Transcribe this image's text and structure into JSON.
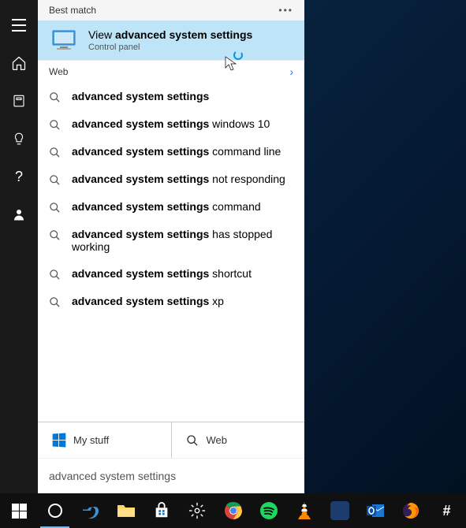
{
  "sidebar": {
    "items": [
      "menu",
      "home",
      "recent",
      "tips",
      "help",
      "account"
    ]
  },
  "panel": {
    "best_match_label": "Best match",
    "best_match": {
      "prefix": "View ",
      "bold": "advanced system settings",
      "sub": "Control panel"
    },
    "web_label": "Web",
    "results": [
      {
        "bold": "advanced system settings",
        "rest": ""
      },
      {
        "bold": "advanced system settings",
        "rest": " windows 10"
      },
      {
        "bold": "advanced system settings",
        "rest": " command line"
      },
      {
        "bold": "advanced system settings",
        "rest": " not responding"
      },
      {
        "bold": "advanced system settings",
        "rest": " command"
      },
      {
        "bold": "advanced system settings",
        "rest": " has stopped working"
      },
      {
        "bold": "advanced system settings",
        "rest": " shortcut"
      },
      {
        "bold": "advanced system settings",
        "rest": " xp"
      }
    ],
    "tabs": {
      "mystuff": "My stuff",
      "web": "Web"
    },
    "query": "advanced system settings"
  },
  "taskbar": {
    "items": [
      "start",
      "cortana",
      "edge",
      "file-explorer",
      "store",
      "settings",
      "chrome",
      "spotify",
      "vlc",
      "photoshop",
      "outlook",
      "firefox",
      "slack"
    ]
  }
}
